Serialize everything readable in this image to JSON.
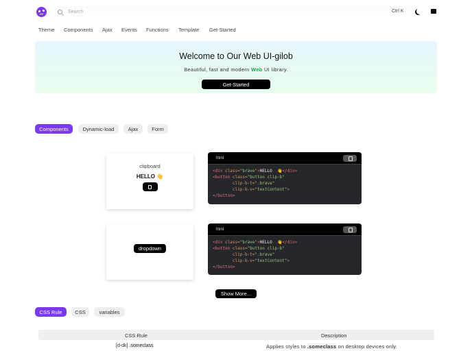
{
  "header": {
    "search_placeholder": "Search",
    "shortcut": "Ctrl K"
  },
  "nav": [
    "Theme",
    "Components",
    "Ajax",
    "Events",
    "Functions",
    "Template",
    "Get-Started"
  ],
  "hero": {
    "title": "Welcome to Our Web UI-gilob",
    "subtitle_pre": "Beautiful, fast and modern",
    "subtitle_highlight": "Web",
    "subtitle_post": "UI library.",
    "button": "Get-Started",
    "accent": "#16a34a"
  },
  "tabs": [
    {
      "label": "Components",
      "active": true
    },
    {
      "label": "Dynamic-load"
    },
    {
      "label": "Ajax"
    },
    {
      "label": "Form"
    }
  ],
  "demos": [
    {
      "title": "clipboard",
      "text": "HELLO 👋",
      "lang": "html"
    },
    {
      "button": "dropdown",
      "lang": "html"
    }
  ],
  "code": [
    [
      [
        "t-tag",
        "<div "
      ],
      [
        "t-attr",
        "class="
      ],
      [
        "t-str",
        "\"brave\""
      ],
      [
        "t-tag",
        ">"
      ],
      [
        "t-txt",
        "HELLO  👋"
      ],
      [
        "t-tag",
        "</div>"
      ]
    ],
    [
      [
        "t-tag",
        "<button "
      ],
      [
        "t-attr",
        "class="
      ],
      [
        "t-str",
        "\"button clip-b\""
      ]
    ],
    [
      [
        "t-txt",
        "        "
      ],
      [
        "t-attr",
        "clip-b-t="
      ],
      [
        "t-str",
        "\".brave\""
      ]
    ],
    [
      [
        "t-txt",
        "        "
      ],
      [
        "t-attr",
        "clip-b-v="
      ],
      [
        "t-str",
        "\"textContent\""
      ],
      [
        "t-tag",
        ">"
      ]
    ],
    [
      [
        "t-tag",
        "</button>"
      ]
    ]
  ],
  "show_more": "Show More...",
  "css_tabs": [
    {
      "label": "CSS Rule",
      "active": true
    },
    {
      "label": "CSS"
    },
    {
      "label": "variables"
    }
  ],
  "table": {
    "headers": [
      "CSS Rule",
      "Description"
    ],
    "rows": [
      {
        "rule_prefix": "[d-dk]",
        "rule_class": ".someclass",
        "desc_pre": "Applies styles to",
        "desc_code": ".someclass",
        "desc_post": "on desktop devices only."
      }
    ]
  },
  "colors": {
    "brand": "#7c3aed"
  }
}
